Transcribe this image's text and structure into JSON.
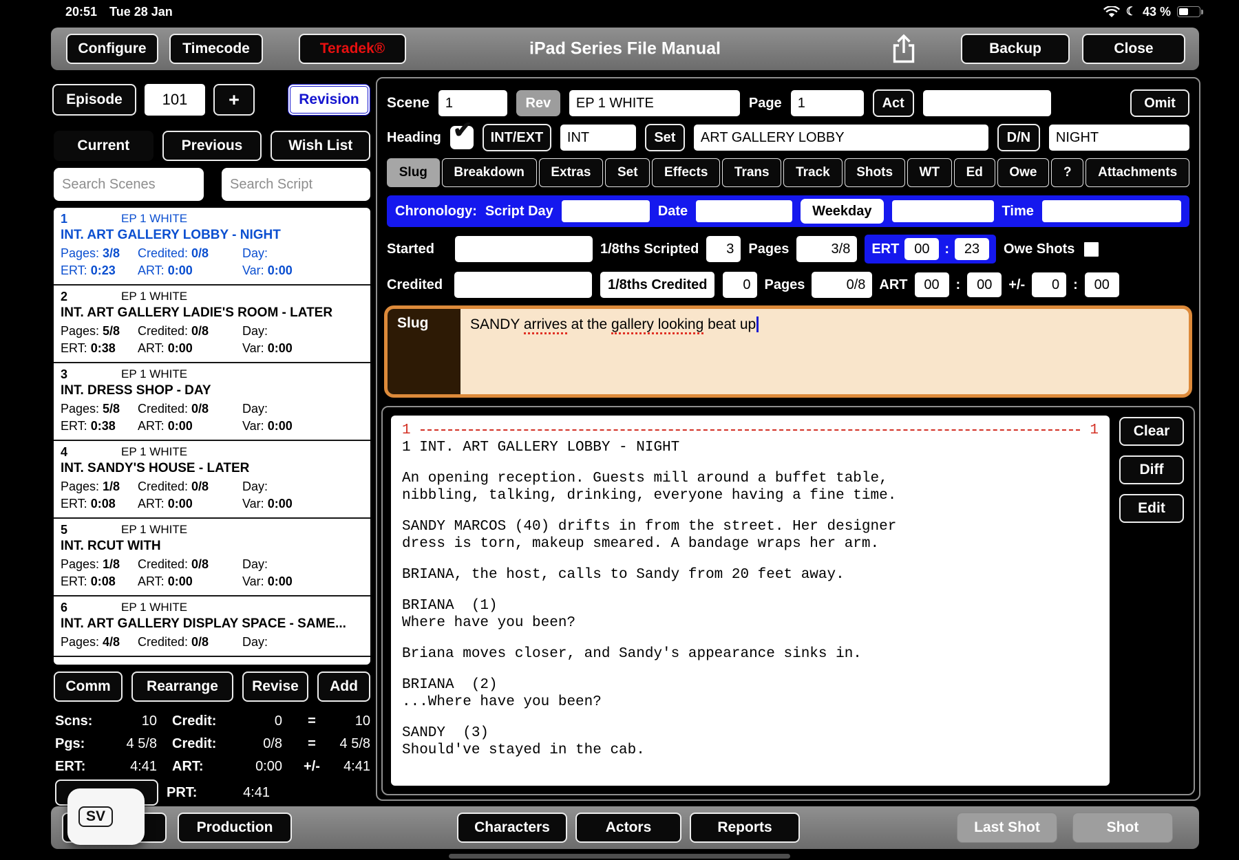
{
  "status_bar": {
    "time": "20:51",
    "date": "Tue 28 Jan",
    "battery": "43 %"
  },
  "toolbar": {
    "configure": "Configure",
    "timecode": "Timecode",
    "teradek": "Teradek®",
    "title": "iPad Series File Manual",
    "backup": "Backup",
    "close": "Close"
  },
  "left_panel": {
    "episode_label": "Episode",
    "episode_number": "101",
    "add_button": "+",
    "revision_button": "Revision",
    "tabs": [
      {
        "label": "Current",
        "active": true
      },
      {
        "label": "Previous",
        "active": false
      },
      {
        "label": "Wish List",
        "active": false
      }
    ],
    "search_scenes_placeholder": "Search Scenes",
    "search_script_placeholder": "Search Script",
    "labels": {
      "pages": "Pages:",
      "credited": "Credited:",
      "day": "Day:",
      "ert": "ERT:",
      "art": "ART:",
      "var": "Var:"
    },
    "scenes": [
      {
        "number": "1",
        "revision": "EP 1 WHITE",
        "title": "INT. ART GALLERY LOBBY - NIGHT",
        "pages": "3/8",
        "credited": "0/8",
        "day": "",
        "ert": "0:23",
        "art": "0:00",
        "var": "0:00",
        "selected": true,
        "partial": false
      },
      {
        "number": "2",
        "revision": "EP 1 WHITE",
        "title": "INT. ART GALLERY LADIE'S ROOM - LATER",
        "pages": "5/8",
        "credited": "0/8",
        "day": "",
        "ert": "0:38",
        "art": "0:00",
        "var": "0:00",
        "selected": false,
        "partial": false
      },
      {
        "number": "3",
        "revision": "EP 1 WHITE",
        "title": "INT. DRESS SHOP - DAY",
        "pages": "5/8",
        "credited": "0/8",
        "day": "",
        "ert": "0:38",
        "art": "0:00",
        "var": "0:00",
        "selected": false,
        "partial": false
      },
      {
        "number": "4",
        "revision": "EP 1 WHITE",
        "title": "INT. SANDY'S HOUSE - LATER",
        "pages": "1/8",
        "credited": "0/8",
        "day": "",
        "ert": "0:08",
        "art": "0:00",
        "var": "0:00",
        "selected": false,
        "partial": false
      },
      {
        "number": "5",
        "revision": "EP 1 WHITE",
        "title": "INT. RCUT WITH",
        "pages": "1/8",
        "credited": "0/8",
        "day": "",
        "ert": "0:08",
        "art": "0:00",
        "var": "0:00",
        "selected": false,
        "partial": false
      },
      {
        "number": "6",
        "revision": "EP 1 WHITE",
        "title": "INT. ART GALLERY DISPLAY SPACE - SAME...",
        "pages": "4/8",
        "credited": "0/8",
        "day": "",
        "ert": "",
        "art": "",
        "var": "",
        "selected": false,
        "partial": true
      }
    ],
    "actions": [
      "Comm",
      "Rearrange",
      "Revise",
      "Add"
    ],
    "stats": {
      "rows": [
        {
          "l1": "Scns:",
          "v1": "10",
          "l2": "Credit:",
          "v2": "0",
          "op": "=",
          "v3": "10"
        },
        {
          "l1": "Pgs:",
          "v1": "4 5/8",
          "l2": "Credit:",
          "v2": "0/8",
          "op": "=",
          "v3": "4 5/8"
        },
        {
          "l1": "ERT:",
          "v1": "4:41",
          "l2": "ART:",
          "v2": "0:00",
          "op": "+/-",
          "v3": "4:41"
        }
      ],
      "prt_label": "PRT:",
      "prt_value": "4:41"
    },
    "sv_badge": "SV"
  },
  "right_panel": {
    "scene_label": "Scene",
    "scene_number": "1",
    "rev_button": "Rev",
    "rev_value": "EP 1 WHITE",
    "page_label": "Page",
    "page_value": "1",
    "act_button": "Act",
    "act_value": "",
    "omit_button": "Omit",
    "heading_label": "Heading",
    "intext_button": "INT/EXT",
    "intext_value": "INT",
    "set_button": "Set",
    "set_value": "ART GALLERY LOBBY",
    "dn_button": "D/N",
    "dn_value": "NIGHT",
    "tabs": [
      {
        "label": "Slug",
        "active": true
      },
      {
        "label": "Breakdown"
      },
      {
        "label": "Extras"
      },
      {
        "label": "Set"
      },
      {
        "label": "Effects"
      },
      {
        "label": "Trans"
      },
      {
        "label": "Track"
      },
      {
        "label": "Shots"
      },
      {
        "label": "WT"
      },
      {
        "label": "Ed"
      },
      {
        "label": "Owe"
      },
      {
        "label": "?"
      },
      {
        "label": "Attachments"
      }
    ],
    "chronology": {
      "label": "Chronology:",
      "script_day_label": "Script Day",
      "script_day_value": "",
      "date_label": "Date",
      "date_value": "",
      "weekday_button": "Weekday",
      "weekday_value": "",
      "time_label": "Time",
      "time_value": ""
    },
    "started": {
      "label": "Started",
      "value": "",
      "scripted_label": "1/8ths Scripted",
      "scripted_value": "3",
      "pages_label": "Pages",
      "pages_value": "3/8",
      "ert_label": "ERT",
      "ert_h": "00",
      "ert_m": "23",
      "owe_label": "Owe Shots"
    },
    "credited": {
      "label": "Credited",
      "value": "",
      "credited_button": "1/8ths Credited",
      "credited_value": "0",
      "pages_label": "Pages",
      "pages_value": "0/8",
      "art_label": "ART",
      "art_h": "00",
      "art_m": "00",
      "pm_label": "+/-",
      "pm_h": "0",
      "pm_m": "00"
    },
    "slug": {
      "label": "Slug",
      "text": "SANDY arrives at the gallery looking beat up",
      "segments": [
        {
          "text": "SANDY "
        },
        {
          "text": "arrives",
          "misspelled": true
        },
        {
          "text": " at the "
        },
        {
          "text": "gallery looking",
          "misspelled": true
        },
        {
          "text": " beat up"
        }
      ]
    },
    "script": {
      "page_number_left": "1",
      "page_number_right": "1",
      "lines": [
        {
          "type": "scene",
          "text": "1 INT. ART GALLERY LOBBY - NIGHT"
        },
        {
          "type": "blank"
        },
        {
          "type": "action",
          "text": "An opening reception. Guests mill around a buffet table,"
        },
        {
          "type": "action",
          "text": "nibbling, talking, drinking, everyone having a fine time."
        },
        {
          "type": "blank"
        },
        {
          "type": "action",
          "text": "SANDY MARCOS (40) drifts in from the street. Her designer"
        },
        {
          "type": "action",
          "text": "dress is torn, makeup smeared. A bandage wraps her arm."
        },
        {
          "type": "blank"
        },
        {
          "type": "action",
          "text": "BRIANA, the host, calls to Sandy from 20 feet away."
        },
        {
          "type": "blank"
        },
        {
          "type": "character",
          "text": "BRIANA  (1)"
        },
        {
          "type": "dialogue",
          "text": "Where have you been?"
        },
        {
          "type": "blank"
        },
        {
          "type": "action",
          "text": "Briana moves closer, and Sandy's appearance sinks in."
        },
        {
          "type": "blank"
        },
        {
          "type": "character",
          "text": "BRIANA  (2)"
        },
        {
          "type": "dialogue",
          "text": "...Where have you been?"
        },
        {
          "type": "blank"
        },
        {
          "type": "character",
          "text": "SANDY  (3)"
        },
        {
          "type": "dialogue",
          "text": "Should've stayed in the cab."
        }
      ],
      "clear_button": "Clear",
      "diff_button": "Diff",
      "edit_button": "Edit"
    }
  },
  "bottom_bar": {
    "production": "Production",
    "characters": "Characters",
    "actors": "Actors",
    "reports": "Reports",
    "last_shot": "Last Shot",
    "shot": "Shot"
  },
  "colors": {
    "accent_blue": "#1518ee",
    "selected_scene_blue": "#0b4fd0",
    "slug_border": "#dd8a3a",
    "slug_bg": "#f9e5cb",
    "slug_label_bg": "#2d1a05",
    "script_red": "#d33024",
    "teradek_red": "#e81010"
  }
}
